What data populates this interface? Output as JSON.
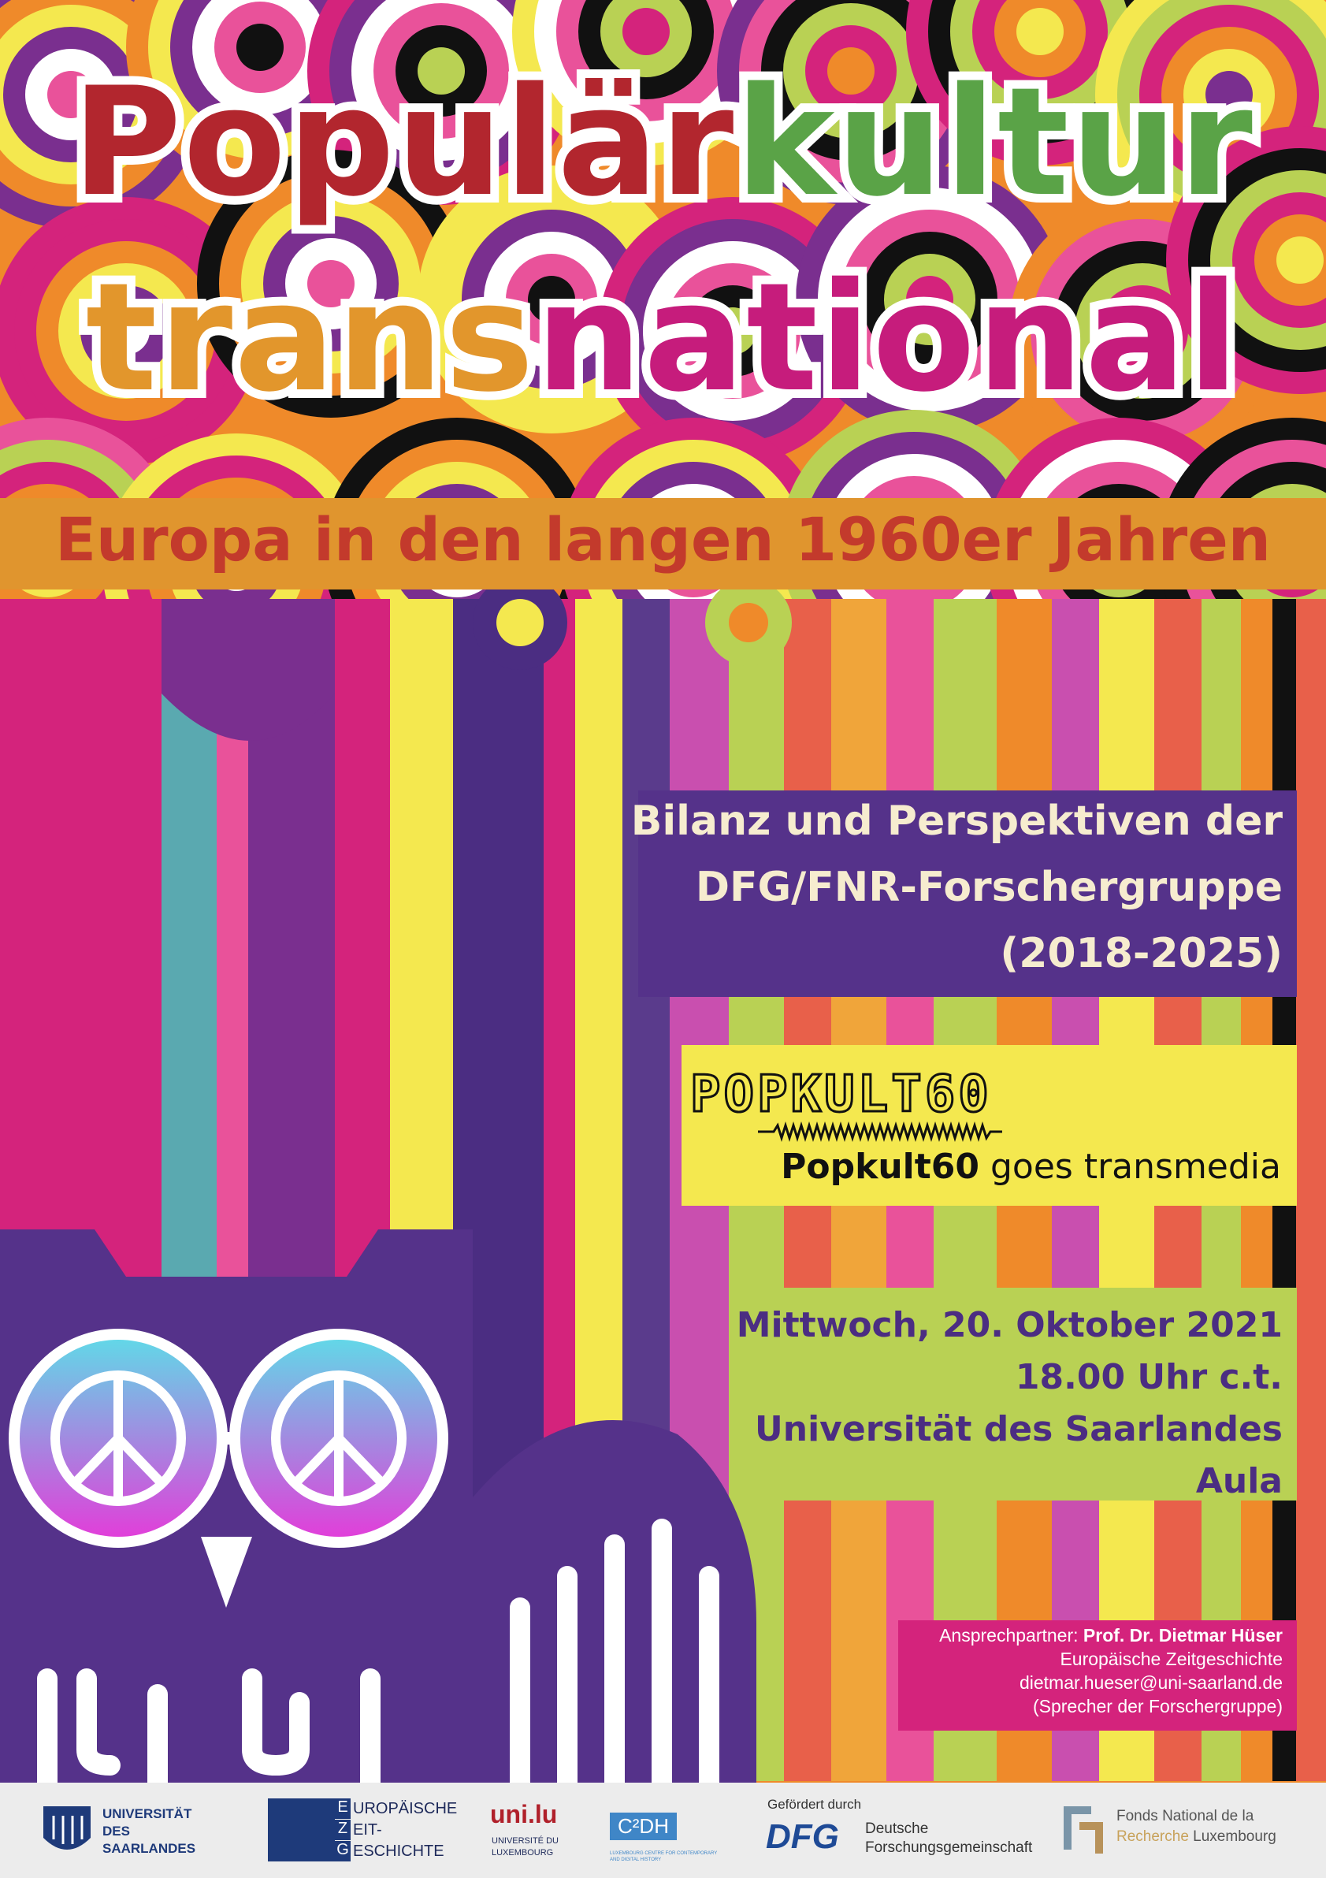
{
  "title": {
    "word1_part1": "Populär",
    "word1_part2": "kultur",
    "word2_part1": "trans",
    "word2_part2": "national"
  },
  "subtitle": "Europa in den langen 1960er Jahren",
  "info_box": {
    "line1": "Bilanz und Perspektiven der",
    "line2": "DFG/FNR-Forschergruppe",
    "line3": "(2018-2025)"
  },
  "popkult": {
    "logo_text": "POPKULT60",
    "tagline_bold": "Popkult60",
    "tagline_rest": " goes transmedia"
  },
  "event": {
    "date": "Mittwoch, 20. Oktober 2021",
    "time": "18.00 Uhr c.t.",
    "venue": "Universität des Saarlandes",
    "room": "Aula"
  },
  "contact": {
    "label": "Ansprechpartner: ",
    "name": "Prof. Dr. Dietmar Hüser",
    "department": "Europäische Zeitgeschichte",
    "email": "dietmar.hueser@uni-saarland.de",
    "role": "(Sprecher der Forschergruppe)"
  },
  "logos": {
    "uds_line1": "UNIVERSITÄT",
    "uds_line2": "DES",
    "uds_line3": "SAARLANDES",
    "ez_line1": "UROPÄISCHE",
    "ez_line2": "EIT-",
    "ez_line3": "ESCHICHTE",
    "ez_initial1": "E",
    "ez_initial2": "Z",
    "ez_initial3": "G",
    "unilu_mark": "uni.lu",
    "unilu_line1": "UNIVERSITÉ DU",
    "unilu_line2": "LUXEMBOURG",
    "c2dh_mark": "C²DH",
    "c2dh_caption": "LUXEMBOURG CENTRE FOR CONTEMPORARY AND DIGITAL HISTORY",
    "dfg_prefix": "Gefördert durch",
    "dfg_mark": "DFG",
    "dfg_line1": "Deutsche",
    "dfg_line2": "Forschungsgemeinschaft",
    "fnr_line1": "Fonds National de la",
    "fnr_line2a": "Recherche",
    "fnr_line2b": " Luxembourg"
  },
  "colors": {
    "title_red": "#b2262e",
    "title_green": "#5aa347",
    "title_orange": "#e2962c",
    "title_magenta": "#c61c7c",
    "subtitle_band": "#e0952e",
    "subtitle_text": "#c33a2c",
    "info_box": "#55328a",
    "popkult_box": "#f4e84f",
    "event_box": "#b9d154",
    "event_text": "#4b2d82",
    "contact_box": "#d4237c",
    "owl": "#55328a"
  }
}
